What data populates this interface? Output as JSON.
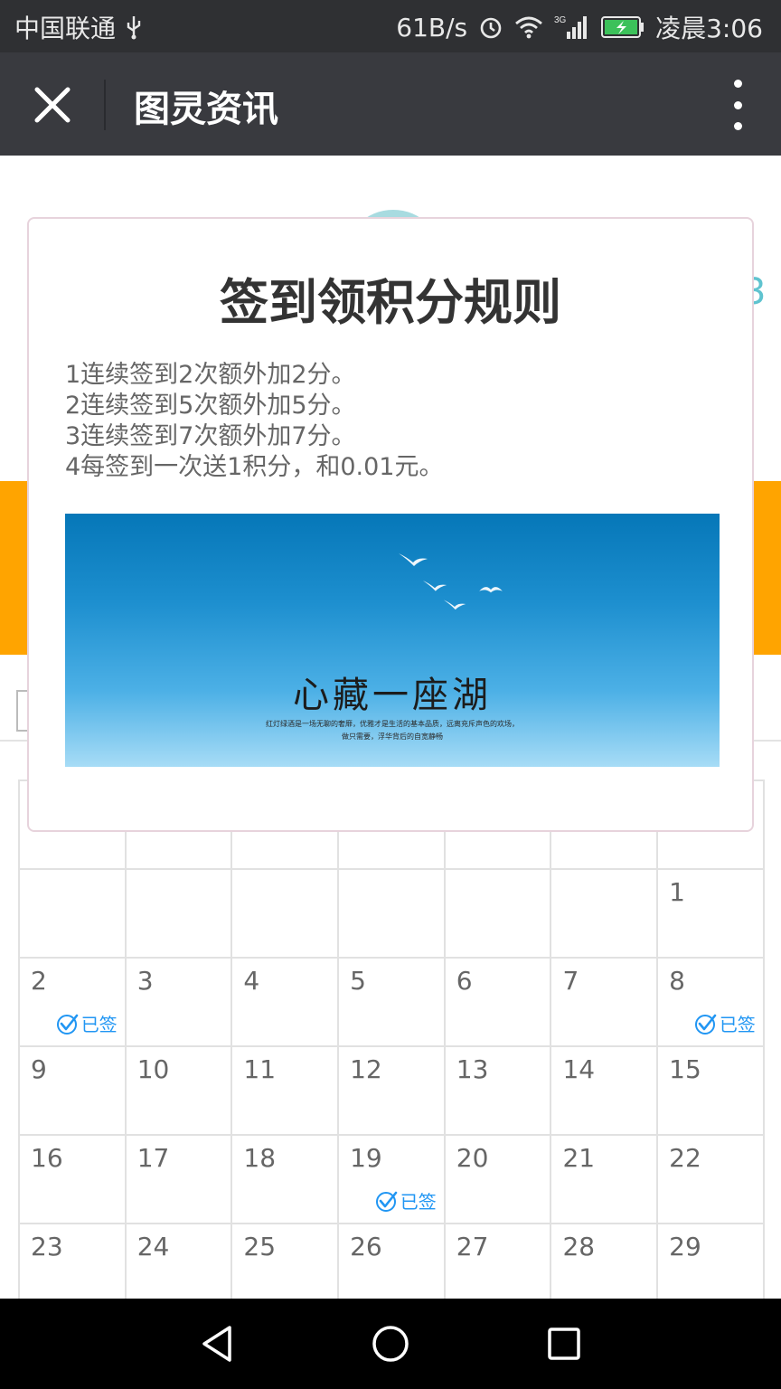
{
  "status_bar": {
    "carrier": "中国联通",
    "net_speed": "61B/s",
    "network_type": "3G",
    "time": "凌晨3:06"
  },
  "title_bar": {
    "title": "图灵资讯"
  },
  "modal": {
    "title": "签到领积分规则",
    "rules": [
      "1连续签到2次额外加2分。",
      "2连续签到5次额外加5分。",
      "3连续签到7次额外加7分。",
      "4每签到一次送1积分，和0.01元。"
    ],
    "banner": {
      "headline": "心藏一座湖",
      "subtitle_line1": "红灯绿酒是一场无聊的奢靡，优雅才是生活的基本品质，远离充斥声色的欢场，",
      "subtitle_line2": "做只需要，浮华背后的自宽静畅"
    }
  },
  "calendar": {
    "signed_label": "已签",
    "weeks": [
      [
        "",
        "",
        "",
        "",
        "",
        "",
        "1"
      ],
      [
        "2",
        "3",
        "4",
        "5",
        "6",
        "7",
        "8"
      ],
      [
        "9",
        "10",
        "11",
        "12",
        "13",
        "14",
        "15"
      ],
      [
        "16",
        "17",
        "18",
        "19",
        "20",
        "21",
        "22"
      ],
      [
        "23",
        "24",
        "25",
        "26",
        "27",
        "28",
        "29"
      ]
    ],
    "signed_days": [
      "2",
      "8",
      "19"
    ]
  },
  "colors": {
    "accent_orange": "#ffa400",
    "signed_blue": "#2196f3",
    "title_bar": "#393a3f"
  }
}
